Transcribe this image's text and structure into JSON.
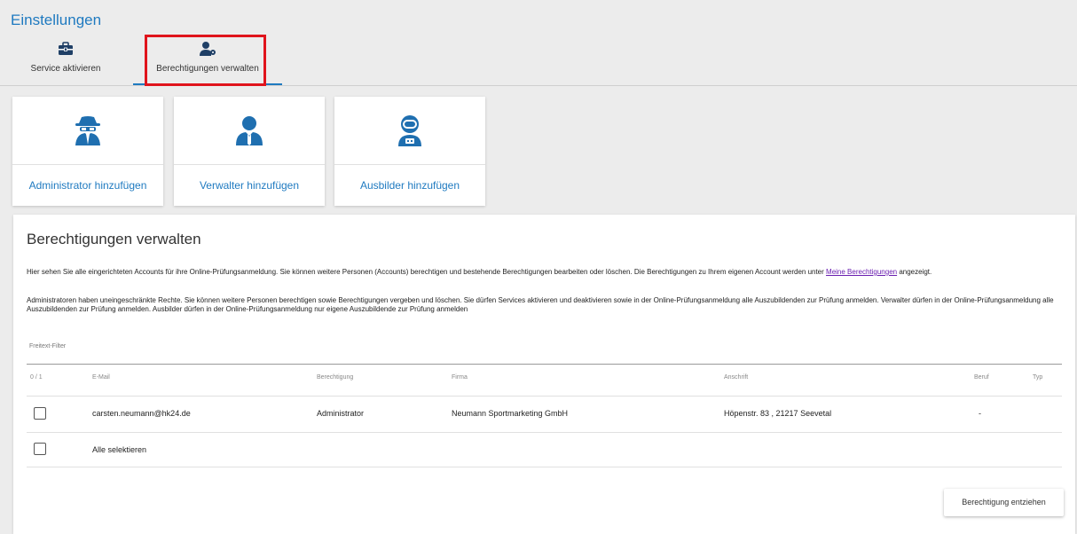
{
  "page": {
    "title": "Einstellungen"
  },
  "tabs": [
    {
      "label": "Service aktivieren",
      "icon": "toolbox-icon"
    },
    {
      "label": "Berechtigungen verwalten",
      "icon": "user-key-icon",
      "active": true
    }
  ],
  "cards": [
    {
      "label": "Administrator hinzufügen",
      "icon": "spy-agent-icon"
    },
    {
      "label": "Verwalter hinzufügen",
      "icon": "user-tie-icon"
    },
    {
      "label": "Ausbilder hinzufügen",
      "icon": "astronaut-icon"
    }
  ],
  "panel": {
    "title": "Berechtigungen verwalten",
    "desc1_pre": "Hier sehen Sie alle eingerichteten Accounts für ihre Online-Prüfungsanmeldung. Sie können weitere Personen (Accounts) berechtigen und bestehende Berechtigungen bearbeiten oder löschen. Die Berechtigungen zu Ihrem eigenen Account werden unter ",
    "desc1_link": "Meine Berechtigungen",
    "desc1_post": " angezeigt.",
    "desc2": "Administratoren haben uneingeschränkte Rechte. Sie können weitere Personen berechtigen sowie Berechtigungen vergeben und löschen. Sie dürfen Services aktivieren und deaktivieren sowie in der Online-Prüfungsanmeldung alle Auszubildenden zur Prüfung anmelden. Verwalter dürfen in der Online-Prüfungsanmeldung alle Auszubildenden zur Prüfung anmelden. Ausbilder dürfen in der Online-Prüfungsanmeldung nur eigene Auszubildende zur Prüfung anmelden",
    "filter_label": "Freitext-Filter"
  },
  "table": {
    "headers": {
      "count": "0 / 1",
      "email": "E-Mail",
      "role": "Berechtigung",
      "company": "Firma",
      "address": "Anschrift",
      "job": "Beruf",
      "type": "Typ"
    },
    "rows": [
      {
        "email": "carsten.neumann@hk24.de",
        "role": "Administrator",
        "company": "Neumann Sportmarketing GmbH",
        "address": "Höpenstr. 83 , 21217 Seevetal",
        "job": "-"
      }
    ],
    "select_all": "Alle selektieren"
  },
  "actions": {
    "revoke": "Berechtigung entziehen"
  },
  "colors": {
    "accent": "#1f7ac0",
    "highlight": "#e0141c"
  }
}
